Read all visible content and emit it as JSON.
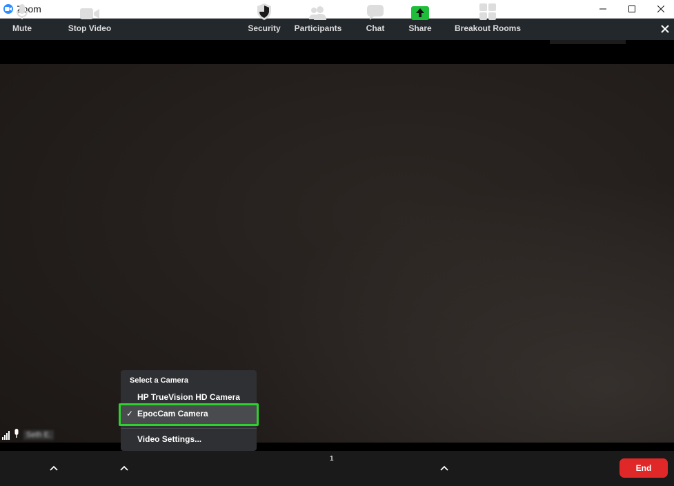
{
  "window": {
    "title": "Zoom",
    "controls": [
      "minimize",
      "maximize",
      "close"
    ]
  },
  "participant": {
    "name": "Seth E."
  },
  "camera_menu": {
    "header": "Select a Camera",
    "items": [
      {
        "label": "HP TrueVision HD Camera",
        "selected": false
      },
      {
        "label": "EpocCam Camera",
        "selected": true
      }
    ],
    "settings_label": "Video Settings...",
    "check_glyph": "✓"
  },
  "toolbar": {
    "mute_label": "Mute",
    "stop_video_label": "Stop Video",
    "security_label": "Security",
    "participants_label": "Participants",
    "participants_count": "1",
    "chat_label": "Chat",
    "share_label": "Share",
    "breakout_label": "Breakout Rooms",
    "end_label": "End"
  },
  "colors": {
    "accent_highlight": "#2fd02f",
    "end_button": "#e02828",
    "share_green": "#1fbe3a",
    "zoom_blue": "#2d8cff"
  }
}
